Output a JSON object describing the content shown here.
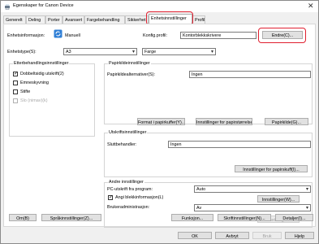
{
  "window": {
    "title": "Egenskaper for Canon Device"
  },
  "tabs": [
    "Generelt",
    "Deling",
    "Porter",
    "Avansert",
    "Fargebehandling",
    "Sikkerhet",
    "Enhetsinnstillinger",
    "Profil"
  ],
  "device": {
    "info_label": "Enhetsinformasjon:",
    "mode": "Manuell",
    "config_profile_label": "Konfig.profil:",
    "config_profile_value": "Kontorblekkskrivere",
    "change_button": "Endre(C)..."
  },
  "device_type": {
    "label": "Enhetstype(S):",
    "paper_size": "A3",
    "color_mode": "Farge"
  },
  "finishing": {
    "title": "Etterbehandlingsinnstillinger",
    "duplex": "Dobbeltsidig utskrift(2)",
    "staple_wait": "Emneskyvning",
    "staple": "Stifte",
    "punch": "Slo (nimav)(k)"
  },
  "paper_source": {
    "title": "Papirkildeinnstillinger",
    "label": "Papirkildealternativer(S):",
    "value": "Ingen",
    "btn_format": "Format i papirkuffer(Y)...",
    "btn_paper_settings": "Innstillinger for papirstørrelse(E)...",
    "btn_paper_source": "Papirkilde(G)..."
  },
  "output": {
    "title": "Utskriftsinnstillinger",
    "label": "Sluttbehandler:",
    "value": "Ingen",
    "btn_output_tray": "Innstillinger for papirskuff(I)..."
  },
  "other": {
    "title": "Andre innstillinger",
    "pc_label": "PC-utskrift fra program:",
    "pc_value": "Auto",
    "ink_label": "Angi blekkinformasjon(L)",
    "ink_button": "Innstillinger(W)...",
    "user_mgmt_label": "Brukeradministrasjon:",
    "user_mgmt_value": "Av",
    "user_mgmt_button": "Innstillinger..."
  },
  "bottom_buttons": {
    "about": "Om(B)",
    "language": "Språkinnstillinger(Z)...",
    "function": "Funksjon...",
    "printer_settings": "Skriftinnstillinger(N)...",
    "details": "Detaljer(I)..."
  },
  "dialog_buttons": {
    "ok": "OK",
    "cancel": "Avbryt",
    "apply": "Bruk",
    "help": "Hjelp"
  }
}
